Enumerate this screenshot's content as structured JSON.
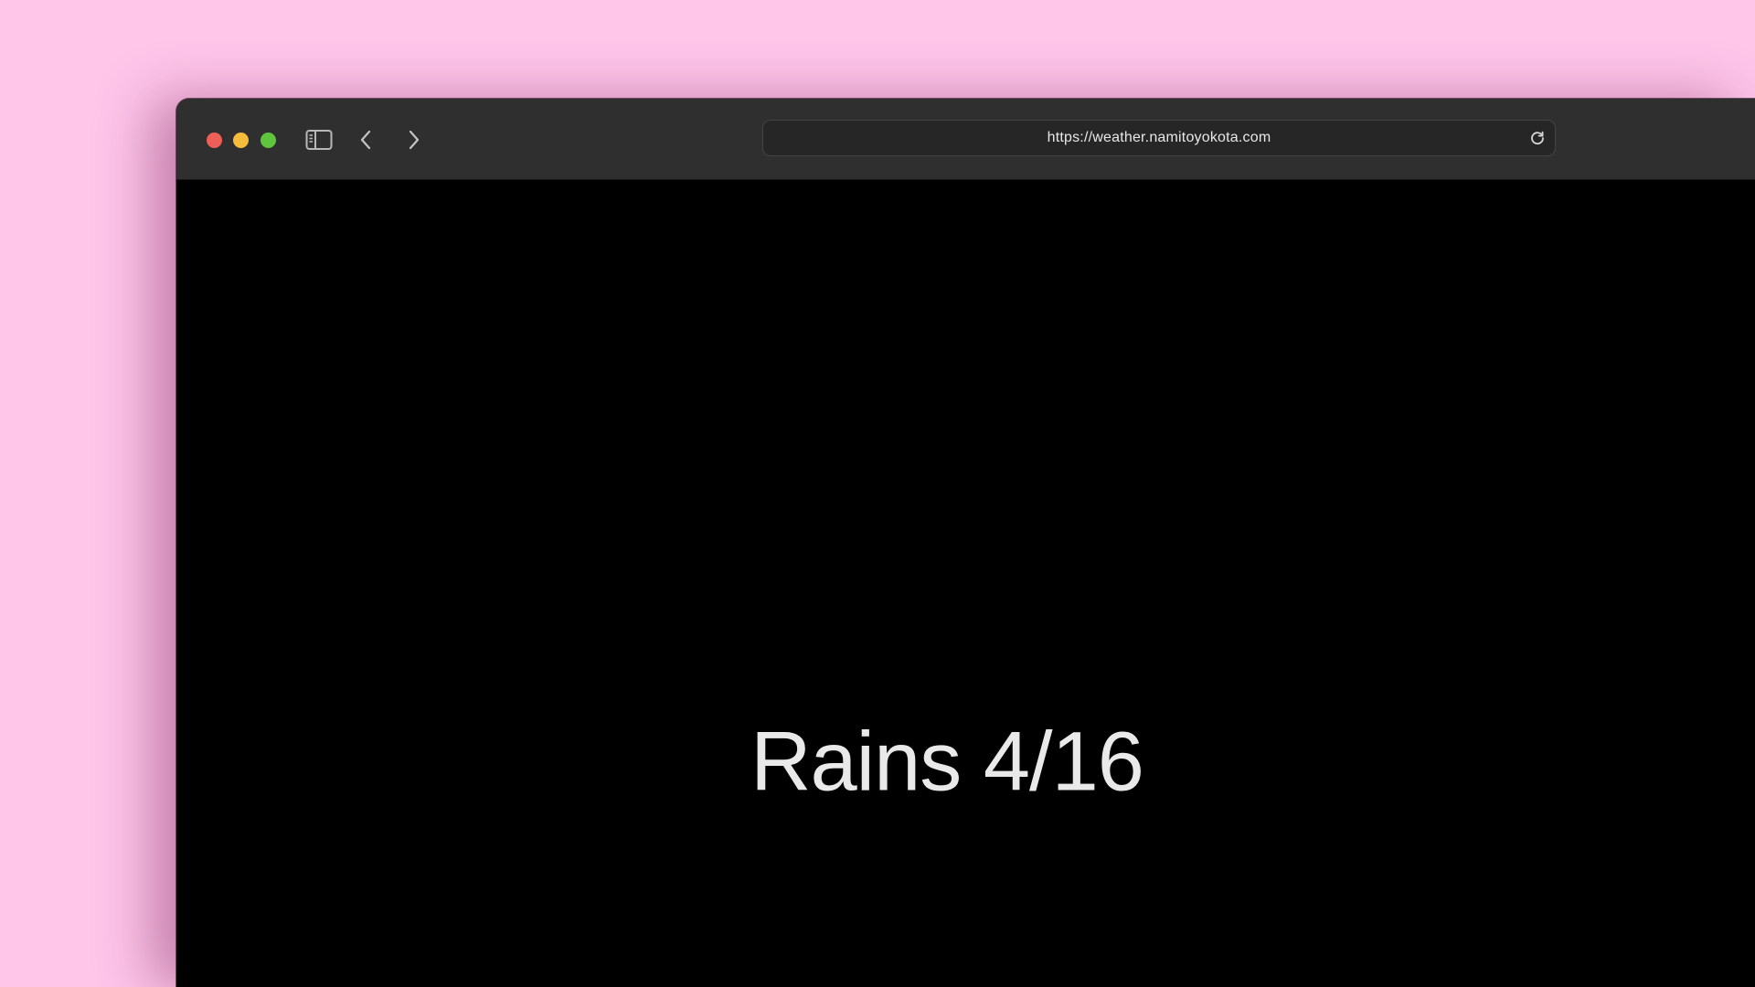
{
  "browser": {
    "url": "https://weather.namitoyokota.com",
    "controls": {
      "sidebar_icon": "sidebar-icon",
      "back_icon": "chevron-left-icon",
      "forward_icon": "chevron-right-icon",
      "reload_icon": "reload-icon"
    },
    "traffic_lights": {
      "close": "#ee5f57",
      "minimize": "#f6bd3d",
      "maximize": "#5fc53e"
    }
  },
  "page": {
    "headline": "Rains 4/16"
  },
  "colors": {
    "desktop_background": "#ffc6ea",
    "page_background": "#000000",
    "headline_text": "#e9e9e9"
  }
}
